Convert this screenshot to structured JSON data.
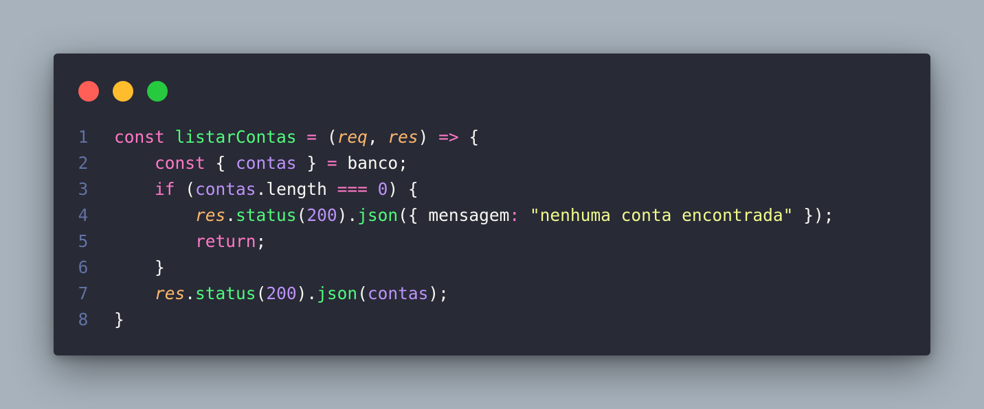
{
  "window": {
    "controls": [
      "close",
      "minimize",
      "maximize"
    ],
    "colors": {
      "background": "#282a36",
      "close": "#ff5f56",
      "minimize": "#ffbd2e",
      "maximize": "#27c93f"
    }
  },
  "code": {
    "language": "javascript",
    "theme_colors": {
      "keyword": "#ff79c6",
      "function": "#50fa7b",
      "parameter": "#ffb86c",
      "number": "#bd93f9",
      "string": "#f1fa8c",
      "line_number": "#6272a4"
    },
    "lines": [
      {
        "number": "1",
        "tokens": [
          {
            "t": "const ",
            "c": "kw"
          },
          {
            "t": "listarContas",
            "c": "fn"
          },
          {
            "t": " ",
            "c": "pl"
          },
          {
            "t": "=",
            "c": "op"
          },
          {
            "t": " (",
            "c": "pl"
          },
          {
            "t": "req",
            "c": "pa"
          },
          {
            "t": ", ",
            "c": "pl"
          },
          {
            "t": "res",
            "c": "pa"
          },
          {
            "t": ") ",
            "c": "pl"
          },
          {
            "t": "=>",
            "c": "op"
          },
          {
            "t": " {",
            "c": "pl"
          }
        ]
      },
      {
        "number": "2",
        "tokens": [
          {
            "t": "    ",
            "c": "pl"
          },
          {
            "t": "const",
            "c": "kw"
          },
          {
            "t": " { ",
            "c": "pl"
          },
          {
            "t": "contas",
            "c": "vr"
          },
          {
            "t": " } ",
            "c": "pl"
          },
          {
            "t": "=",
            "c": "op"
          },
          {
            "t": " banco;",
            "c": "pl"
          }
        ]
      },
      {
        "number": "3",
        "tokens": [
          {
            "t": "    ",
            "c": "pl"
          },
          {
            "t": "if",
            "c": "kw"
          },
          {
            "t": " (",
            "c": "pl"
          },
          {
            "t": "contas",
            "c": "vr"
          },
          {
            "t": ".length ",
            "c": "pl"
          },
          {
            "t": "===",
            "c": "op"
          },
          {
            "t": " ",
            "c": "pl"
          },
          {
            "t": "0",
            "c": "nu"
          },
          {
            "t": ") {",
            "c": "pl"
          }
        ]
      },
      {
        "number": "4",
        "tokens": [
          {
            "t": "        ",
            "c": "pl"
          },
          {
            "t": "res",
            "c": "pa"
          },
          {
            "t": ".",
            "c": "pl"
          },
          {
            "t": "status",
            "c": "fn"
          },
          {
            "t": "(",
            "c": "pl"
          },
          {
            "t": "200",
            "c": "nu"
          },
          {
            "t": ").",
            "c": "pl"
          },
          {
            "t": "json",
            "c": "fn"
          },
          {
            "t": "({ mensagem",
            "c": "pl"
          },
          {
            "t": ":",
            "c": "op"
          },
          {
            "t": " ",
            "c": "pl"
          },
          {
            "t": "\"nenhuma conta encontrada\"",
            "c": "st"
          },
          {
            "t": " });",
            "c": "pl"
          }
        ]
      },
      {
        "number": "5",
        "tokens": [
          {
            "t": "        ",
            "c": "pl"
          },
          {
            "t": "return",
            "c": "kw"
          },
          {
            "t": ";",
            "c": "pl"
          }
        ]
      },
      {
        "number": "6",
        "tokens": [
          {
            "t": "    }",
            "c": "pl"
          }
        ]
      },
      {
        "number": "7",
        "tokens": [
          {
            "t": "    ",
            "c": "pl"
          },
          {
            "t": "res",
            "c": "pa"
          },
          {
            "t": ".",
            "c": "pl"
          },
          {
            "t": "status",
            "c": "fn"
          },
          {
            "t": "(",
            "c": "pl"
          },
          {
            "t": "200",
            "c": "nu"
          },
          {
            "t": ").",
            "c": "pl"
          },
          {
            "t": "json",
            "c": "fn"
          },
          {
            "t": "(",
            "c": "pl"
          },
          {
            "t": "contas",
            "c": "vr"
          },
          {
            "t": ");",
            "c": "pl"
          }
        ]
      },
      {
        "number": "8",
        "tokens": [
          {
            "t": "}",
            "c": "pl"
          }
        ]
      }
    ]
  }
}
